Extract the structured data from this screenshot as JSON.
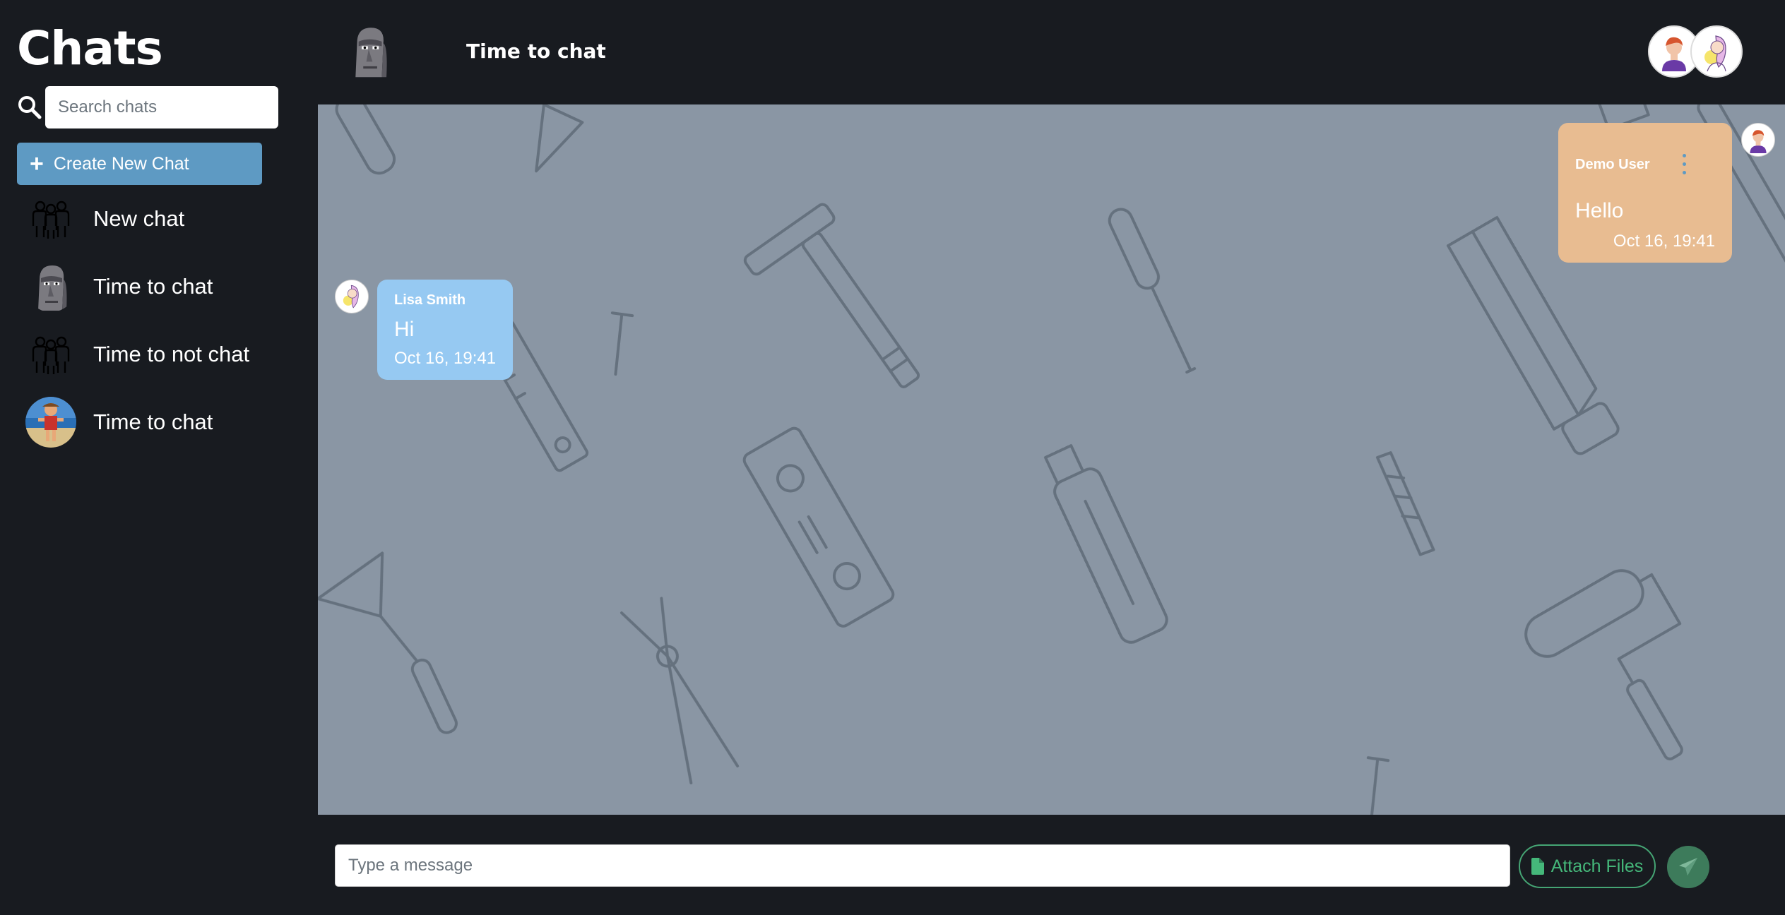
{
  "sidebar": {
    "title": "Chats",
    "search": {
      "placeholder": "Search chats",
      "value": "",
      "icon": "search-icon"
    },
    "create_button": {
      "icon": "plus-icon",
      "label": "Create New Chat"
    },
    "chats": [
      {
        "name": "New chat",
        "avatar": "group-people-icon"
      },
      {
        "name": "Time to chat",
        "avatar": "moai-statue-avatar"
      },
      {
        "name": "Time to not chat",
        "avatar": "group-people-icon"
      },
      {
        "name": "Time to chat",
        "avatar": "beach-photo-avatar"
      }
    ]
  },
  "header": {
    "chat_title": "Time to chat",
    "avatar": "moai-statue-avatar",
    "participants": [
      "red-hair-man-avatar",
      "blonde-woman-avatar"
    ]
  },
  "messages": [
    {
      "sender": "Demo User",
      "text": "Hello",
      "time": "Oct 16, 19:41",
      "side": "right",
      "color": "#e8bc91",
      "avatar": "red-hair-man-avatar",
      "menu_icon": "kebab-menu-icon"
    },
    {
      "sender": "Lisa Smith",
      "text": "Hi",
      "time": "Oct 16, 19:41",
      "side": "left",
      "color": "#96c9f2",
      "avatar": "blonde-woman-avatar"
    }
  ],
  "composer": {
    "placeholder": "Type a message",
    "value": "",
    "attach_label": "Attach Files",
    "attach_icon": "file-icon",
    "send_icon": "paper-plane-icon"
  },
  "colors": {
    "background": "#181b20",
    "chat_area": "#8a96a4",
    "accent_blue": "#5e9ac3",
    "accent_green": "#45a574",
    "send_green": "#3d7b5b"
  }
}
